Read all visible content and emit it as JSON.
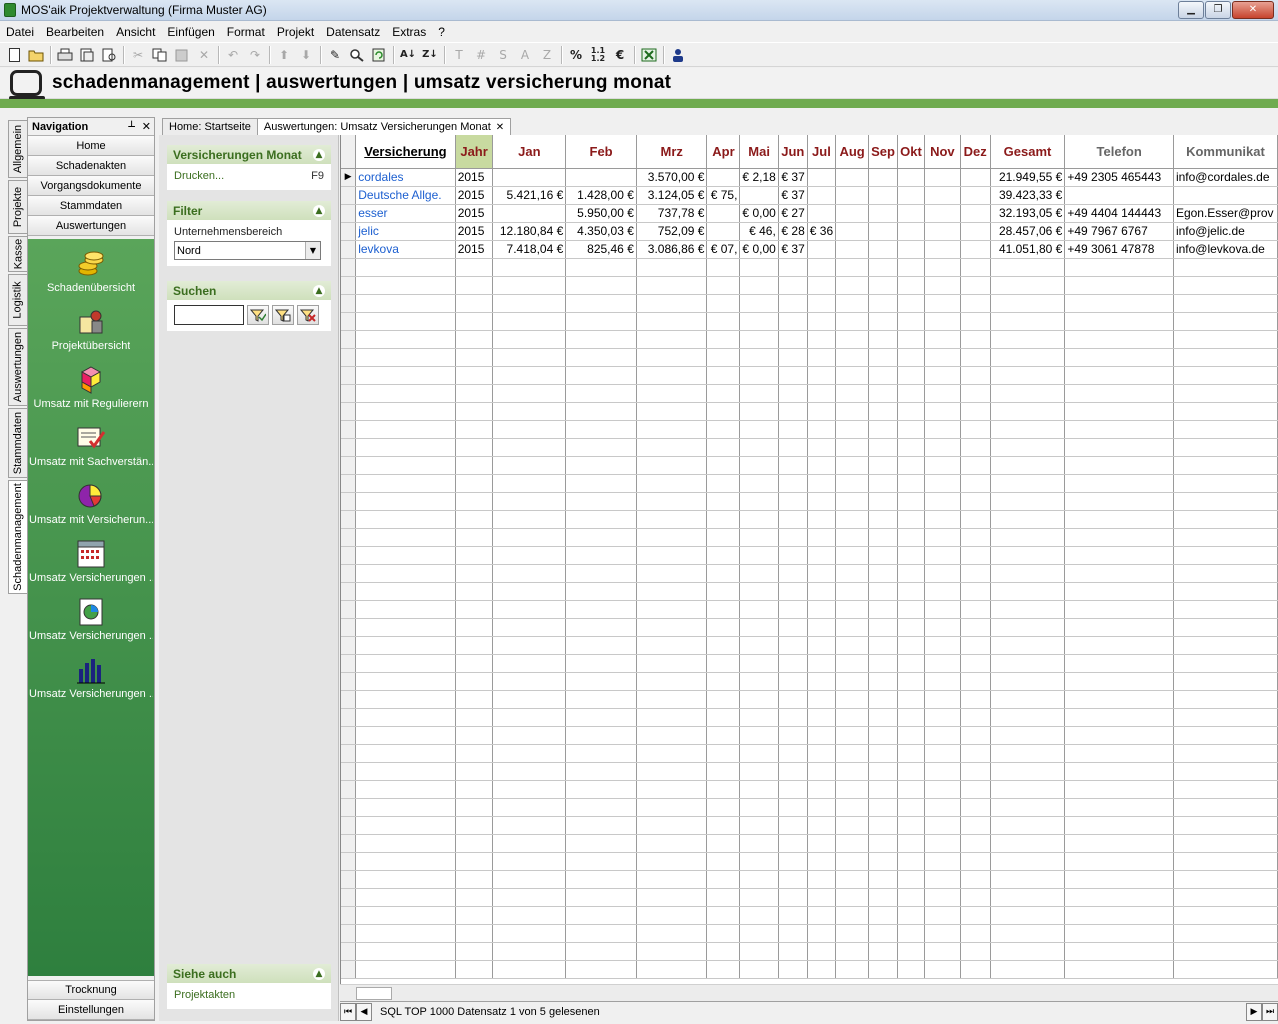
{
  "window": {
    "title": "MOS'aik Projektverwaltung (Firma Muster AG)",
    "minimize": "▁",
    "restore": "❐",
    "close": "✕"
  },
  "menu": [
    "Datei",
    "Bearbeiten",
    "Ansicht",
    "Einfügen",
    "Format",
    "Projekt",
    "Datensatz",
    "Extras",
    "?"
  ],
  "toolbar": {
    "text_buttons": [
      "T",
      "#",
      "S",
      "A",
      "Z"
    ],
    "icons": [
      "new-document-icon",
      "open-folder-icon",
      "print-icon",
      "print-preview-icon",
      "page-preview-icon",
      "cut-icon",
      "copy-icon",
      "paste-icon",
      "delete-icon",
      "undo-icon",
      "redo-icon",
      "move-up-icon",
      "move-down-icon",
      "edit-icon",
      "find-icon",
      "refresh-icon",
      "sort-ascending-icon",
      "sort-descending-icon",
      "percent-icon",
      "decimal-icon",
      "currency-icon",
      "excel-export-icon",
      "user-icon"
    ]
  },
  "banner": {
    "title": "schadenmanagement | auswertungen | umsatz versicherung monat"
  },
  "vtabs": [
    "Allgemein",
    "Projekte",
    "Kasse",
    "Logistik",
    "Auswertungen",
    "Stammdaten",
    "Schadenmanagement"
  ],
  "nav": {
    "title": "Navigation",
    "pin": "📌",
    "close": "✕",
    "buttons": [
      "Home",
      "Schadenakten",
      "Vorgangsdokumente",
      "Stammdaten",
      "Auswertungen"
    ],
    "tiles": [
      {
        "label": "Schadenübersicht",
        "icon": "coins-icon"
      },
      {
        "label": "Projektübersicht",
        "icon": "project-overview-icon"
      },
      {
        "label": "Umsatz mit Regulierern",
        "icon": "cubes-icon"
      },
      {
        "label": "Umsatz mit Sachverstän...",
        "icon": "checklist-icon"
      },
      {
        "label": "Umsatz mit Versicherun...",
        "icon": "pie-chart-icon"
      },
      {
        "label": "Umsatz Versicherungen ...",
        "icon": "calendar-icon"
      },
      {
        "label": "Umsatz Versicherungen ...",
        "icon": "report-chart-icon"
      },
      {
        "label": "Umsatz Versicherungen ...",
        "icon": "bar-chart-icon"
      }
    ],
    "bottom_buttons": [
      "Trocknung",
      "Einstellungen"
    ]
  },
  "doc_tabs": [
    {
      "label": "Home: Startseite",
      "closable": false
    },
    {
      "label": "Auswertungen: Umsatz Versicherungen Monat",
      "closable": true
    }
  ],
  "tasks": {
    "group1": {
      "title": "Versicherungen Monat",
      "link": "Drucken...",
      "shortcut": "F9"
    },
    "filter": {
      "title": "Filter",
      "label": "Unternehmensbereich",
      "value": "Nord"
    },
    "search": {
      "title": "Suchen",
      "value": ""
    },
    "see_also": {
      "title": "Siehe auch",
      "link": "Projektakten"
    }
  },
  "grid": {
    "columns": [
      "Versicherung",
      "Jahr",
      "Jan",
      "Feb",
      "Mrz",
      "Apr",
      "Mai",
      "Jun",
      "Jul",
      "Aug",
      "Sep",
      "Okt",
      "Nov",
      "Dez",
      "Gesamt",
      "Telefon",
      "Kommunikat"
    ],
    "rows": [
      [
        "cordales",
        "2015",
        "",
        "",
        "3.570,00 €",
        "",
        "2,18 €",
        "37 €",
        "",
        "",
        "",
        "",
        "",
        "",
        "21.949,55 €",
        "+49 2305 465443",
        "info@cordales.de"
      ],
      [
        "Deutsche Allge.",
        "2015",
        "5.421,16 €",
        "1.428,00 €",
        "3.124,05 €",
        ",75 €",
        "",
        "37 €",
        "",
        "",
        "",
        "",
        "",
        "",
        "39.423,33 €",
        "",
        ""
      ],
      [
        "esser",
        "2015",
        "",
        "5.950,00 €",
        "737,78 €",
        "",
        "0,00 €",
        "27 €",
        "",
        "",
        "",
        "",
        "",
        "",
        "32.193,05 €",
        "+49 4404 144443",
        "Egon.Esser@prov"
      ],
      [
        "jelic",
        "2015",
        "12.180,84 €",
        "4.350,03 €",
        "752,09 €",
        "",
        ",46 €",
        "28 €",
        "36 €",
        "",
        "",
        "",
        "",
        "",
        "28.457,06 €",
        "+49 7967 6767",
        "info@jelic.de"
      ],
      [
        "levkova",
        "2015",
        "7.418,04 €",
        "825,46 €",
        "3.086,86 €",
        ",07 €",
        "0,00 €",
        "37 €",
        "",
        "",
        "",
        "",
        "",
        "",
        "41.051,80 €",
        "+49 3061 47878",
        "info@levkova.de"
      ]
    ],
    "row_marker": "▶"
  },
  "status": {
    "text": "SQL TOP 1000 Datensatz 1 von 5 gelesenen"
  }
}
